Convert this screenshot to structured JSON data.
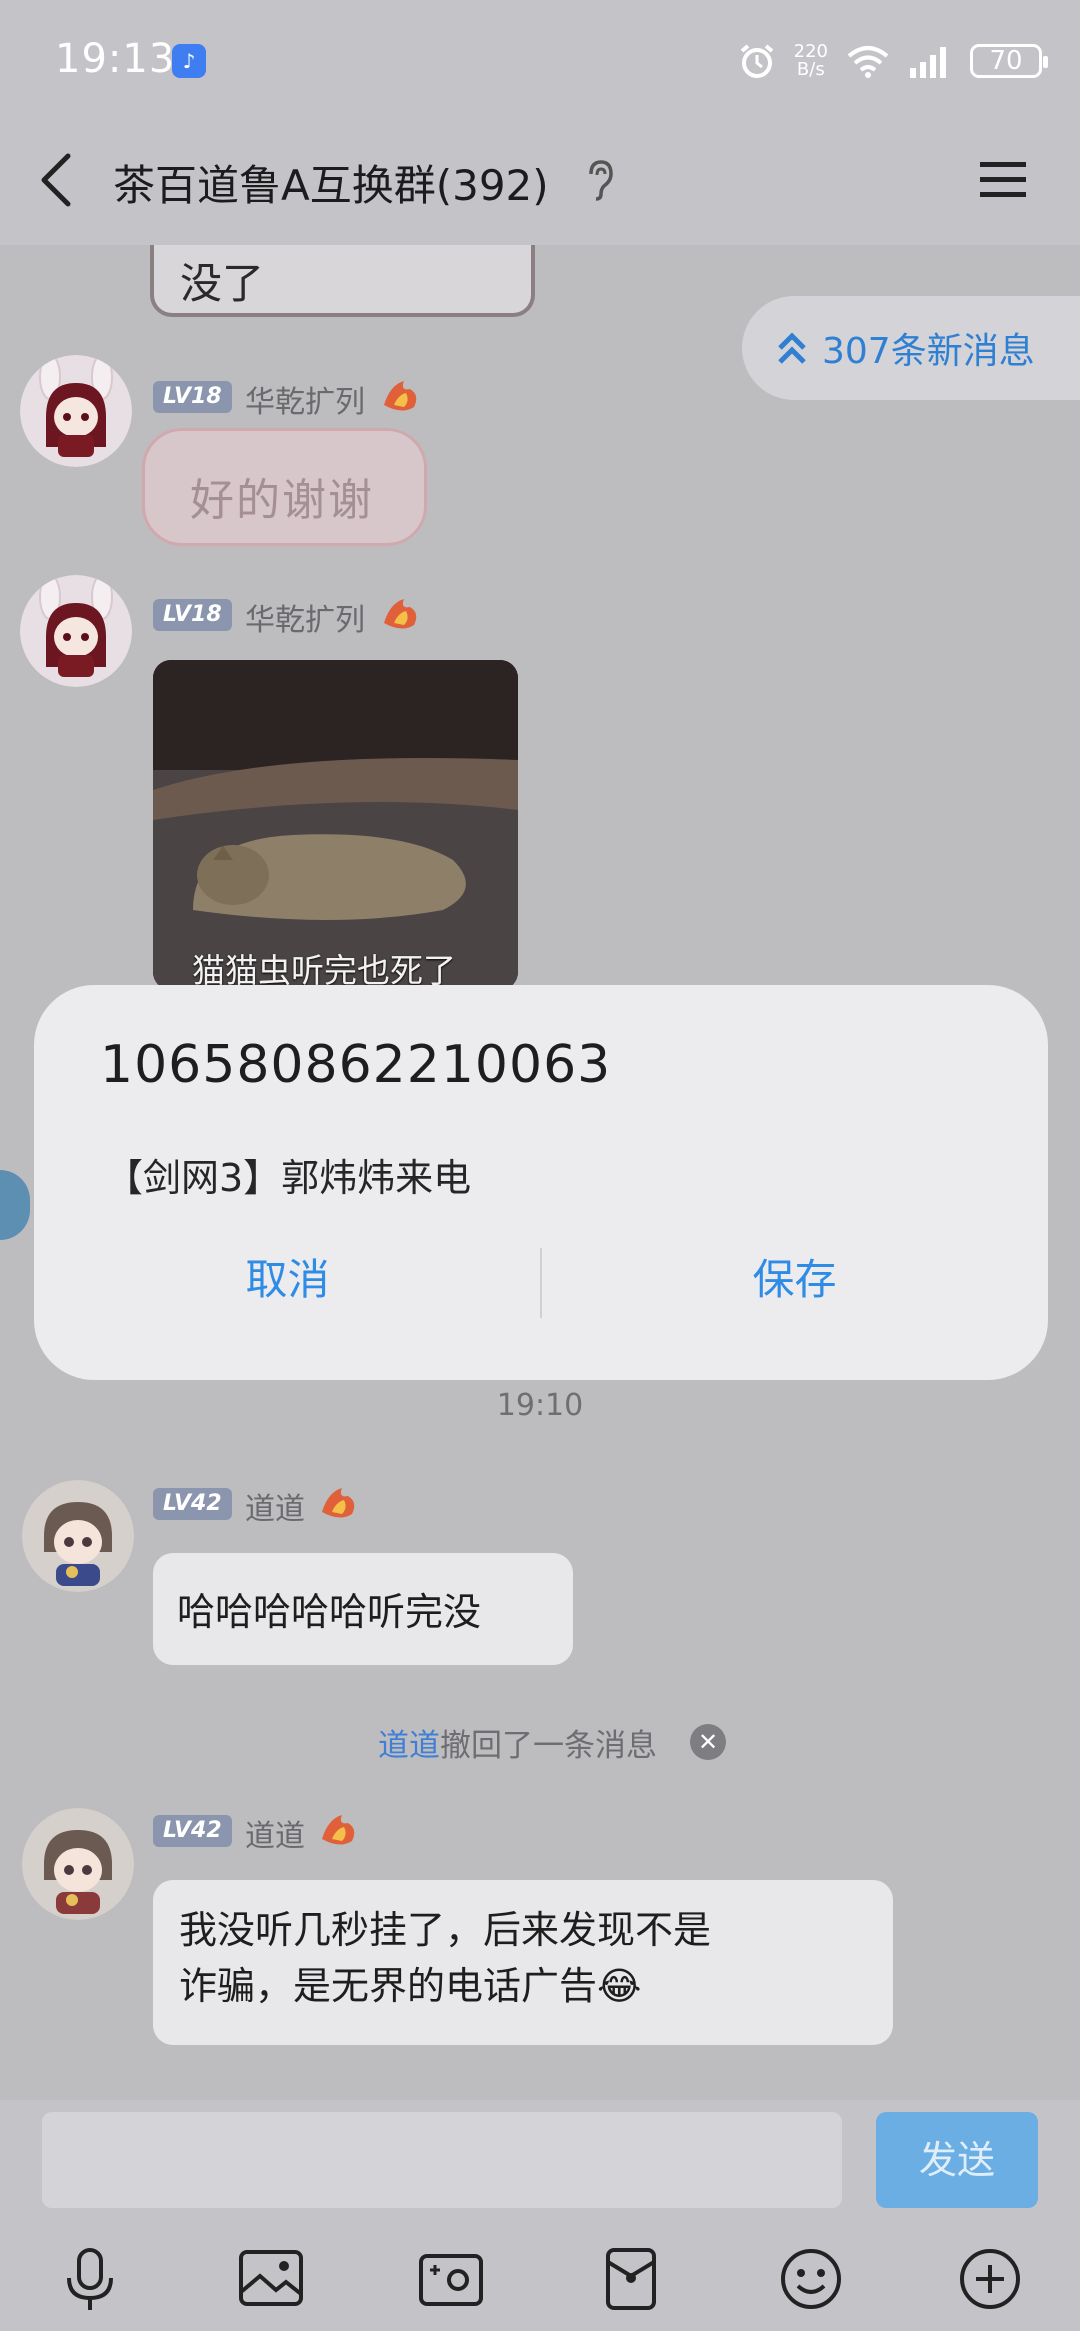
{
  "status_bar": {
    "time": "19:13",
    "net_speed_top": "220",
    "net_speed_bottom": "B/s",
    "battery": "70"
  },
  "header": {
    "title": "茶百道鲁A互换群(392)"
  },
  "chat": {
    "sticker_cut_text": "没了",
    "new_messages": "307条新消息",
    "messages": [
      {
        "level": "LV18",
        "name": "华乾扩列",
        "sticker_text": "好的谢谢"
      },
      {
        "level": "LV18",
        "name": "华乾扩列",
        "photo_caption": "猫猫虫听完也死了"
      },
      {
        "level": "LV42",
        "name": "道道",
        "text": "哈哈哈哈哈听完没"
      },
      {
        "level": "LV42",
        "name": "道道",
        "text_line1": "我没听几秒挂了，后来发现不是",
        "text_line2": "诈骗，是无界的电话广告😂"
      }
    ],
    "time_label": "19:10",
    "recall": {
      "name": "道道",
      "text": "撤回了一条消息"
    }
  },
  "dialog": {
    "number": "106580862210063",
    "message": "【剑网3】郭炜炜来电",
    "cancel": "取消",
    "save": "保存"
  },
  "input": {
    "value": "",
    "send": "发送"
  },
  "colors": {
    "accent": "#2f8ce6",
    "background": "#bdbdc0",
    "send_button": "#6aaee4"
  }
}
